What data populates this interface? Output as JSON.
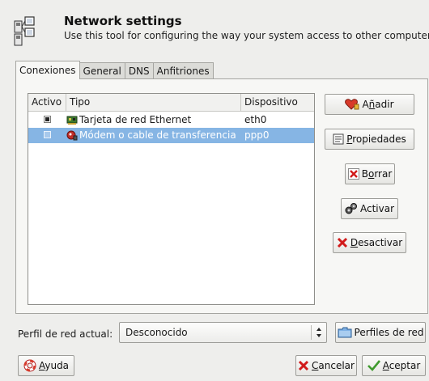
{
  "header": {
    "title": "Network settings",
    "subtitle": "Use this tool for configuring the way your system access to other computers",
    "icon": "network-settings-icon"
  },
  "tabs": [
    {
      "label": "Conexiones",
      "active": true
    },
    {
      "label": "General",
      "active": false
    },
    {
      "label": "DNS",
      "active": false
    },
    {
      "label": "Anfitriones",
      "active": false
    }
  ],
  "connections": {
    "columns": [
      "Activo",
      "Tipo",
      "Dispositivo"
    ],
    "rows": [
      {
        "active": true,
        "type": "Tarjeta de red Ethernet",
        "device": "eth0",
        "icon": "ethernet-card-icon",
        "selected": false
      },
      {
        "active": false,
        "type": "Módem o cable de transferencia",
        "device": "ppp0",
        "icon": "modem-icon",
        "selected": true
      }
    ]
  },
  "actions": {
    "add_prefix": "A",
    "add_ul": "ñ",
    "add_suffix": "adir",
    "properties_prefix": "",
    "properties_ul": "P",
    "properties_suffix": "ropiedades",
    "delete_prefix": "B",
    "delete_ul": "o",
    "delete_suffix": "rrar",
    "activate_prefix": "",
    "activate_ul": "",
    "activate_suffix": "Activar",
    "deactivate_prefix": "",
    "deactivate_ul": "D",
    "deactivate_suffix": "esactivar"
  },
  "profile": {
    "label": "Perfil de red actual:",
    "current": "Desconocido",
    "profiles_button": "Perfiles de red"
  },
  "footer": {
    "help_prefix": "",
    "help_ul": "A",
    "help_suffix": "yuda",
    "cancel_prefix": "",
    "cancel_ul": "C",
    "cancel_suffix": "ancelar",
    "accept_prefix": "",
    "accept_ul": "A",
    "accept_suffix": "ceptar"
  },
  "colors": {
    "window_bg": "#eeeeec",
    "selection": "#86b5e4",
    "panel_bg": "#f7f7f5"
  }
}
